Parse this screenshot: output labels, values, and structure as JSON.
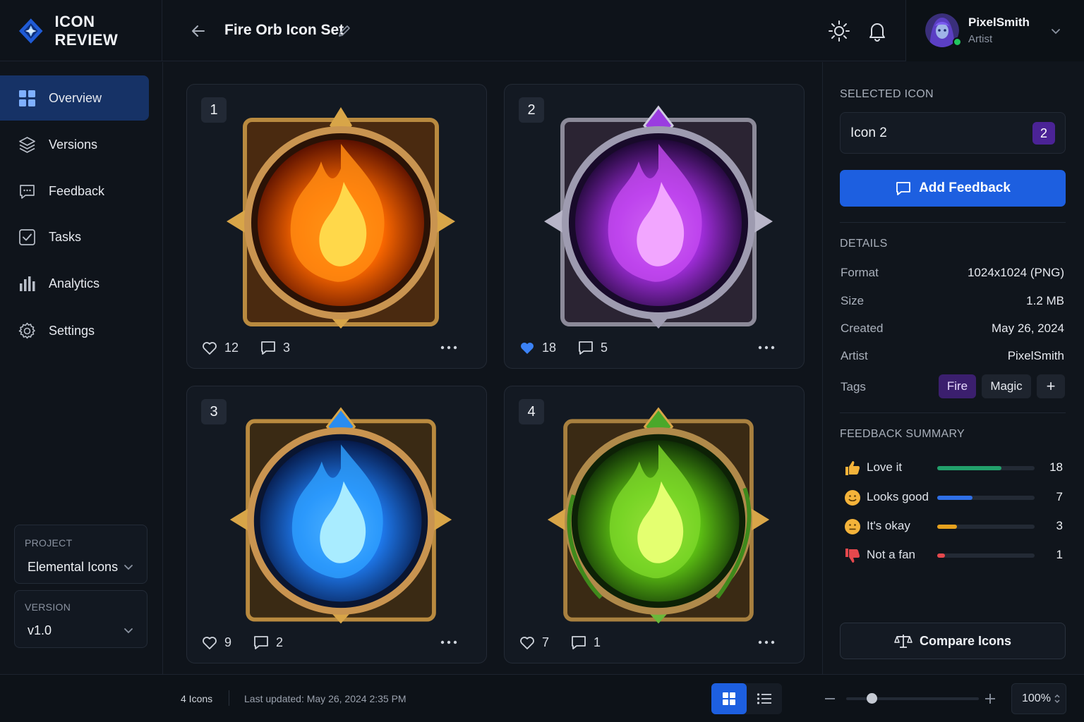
{
  "brand": {
    "title": "ICON REVIEW"
  },
  "header": {
    "page_title": "Fire Orb Icon Set"
  },
  "user": {
    "name": "PixelSmith",
    "role": "Artist"
  },
  "sidebar": {
    "items": [
      {
        "label": "Overview",
        "icon": "grid-icon",
        "active": true
      },
      {
        "label": "Versions",
        "icon": "layers-icon"
      },
      {
        "label": "Feedback",
        "icon": "chat-icon"
      },
      {
        "label": "Tasks",
        "icon": "checkbox-icon"
      },
      {
        "label": "Analytics",
        "icon": "bar-chart-icon"
      },
      {
        "label": "Settings",
        "icon": "gear-icon"
      }
    ],
    "project": {
      "label": "PROJECT",
      "value": "Elemental Icons"
    },
    "version": {
      "label": "VERSION",
      "value": "v1.0"
    }
  },
  "icons": [
    {
      "number": "1",
      "likes": "12",
      "comments": "3",
      "liked": false,
      "theme": "fire-orange"
    },
    {
      "number": "2",
      "likes": "18",
      "comments": "5",
      "liked": true,
      "theme": "fire-purple"
    },
    {
      "number": "3",
      "likes": "9",
      "comments": "2",
      "liked": false,
      "theme": "fire-blue"
    },
    {
      "number": "4",
      "likes": "7",
      "comments": "1",
      "liked": false,
      "theme": "fire-green"
    }
  ],
  "panel": {
    "selected_heading": "SELECTED ICON",
    "selected_name": "Icon 2",
    "selected_number": "2",
    "add_feedback": "Add Feedback",
    "details_heading": "DETAILS",
    "details": [
      {
        "key": "Format",
        "value": "1024x1024 (PNG)"
      },
      {
        "key": "Size",
        "value": "1.2 MB"
      },
      {
        "key": "Created",
        "value": "May 26, 2024"
      },
      {
        "key": "Artist",
        "value": "PixelSmith"
      }
    ],
    "tags_label": "Tags",
    "tags": [
      "Fire",
      "Magic"
    ],
    "add_tag": "+",
    "feedback_heading": "FEEDBACK SUMMARY",
    "feedback": [
      {
        "label": "Love it",
        "count": "18",
        "fraction": 0.66,
        "color": "#22a06b",
        "icon": "thumbs-up-icon"
      },
      {
        "label": "Looks good",
        "count": "7",
        "fraction": 0.36,
        "color": "#2f6fe6",
        "icon": "smile-icon"
      },
      {
        "label": "It's okay",
        "count": "3",
        "fraction": 0.2,
        "color": "#e6a11e",
        "icon": "neutral-face-icon"
      },
      {
        "label": "Not a fan",
        "count": "1",
        "fraction": 0.08,
        "color": "#e5484d",
        "icon": "thumbs-down-icon"
      }
    ],
    "compare": "Compare Icons"
  },
  "footer": {
    "icons_count": "4 Icons",
    "last_updated": "Last updated: May 26, 2024 2:35 PM",
    "zoom": "100%"
  },
  "colors": {
    "accent": "#1d5fe0",
    "tag_purple": "#3b1f6e"
  }
}
